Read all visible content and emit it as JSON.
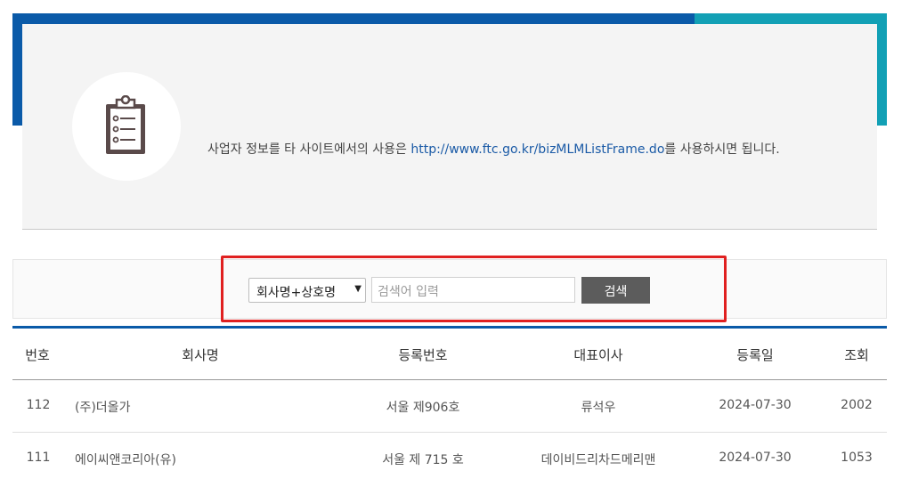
{
  "info": {
    "text_before": "사업자 정보를 타 사이트에서의 사용은 ",
    "link": "http://www.ftc.go.kr/bizMLMListFrame.do",
    "text_after": "를 사용하시면 됩니다.",
    "icon": "clipboard-list-icon"
  },
  "search": {
    "select_value": "회사명+상호명",
    "placeholder": "검색어 입력",
    "button_label": "검색"
  },
  "table": {
    "headers": {
      "no": "번호",
      "company": "회사명",
      "reg_no": "등록번호",
      "ceo": "대표이사",
      "reg_date": "등록일",
      "views": "조회"
    },
    "rows": [
      {
        "no": "112",
        "company": "(주)더올가",
        "reg_no": "서울 제906호",
        "ceo": "류석우",
        "reg_date": "2024-07-30",
        "views": "2002"
      },
      {
        "no": "111",
        "company": "에이씨앤코리아(유)",
        "reg_no": "서울 제 715 호",
        "ceo": "데이비드리차드메리맨",
        "reg_date": "2024-07-30",
        "views": "1053"
      }
    ]
  },
  "colors": {
    "frame_blue": "#0a5aa8",
    "frame_teal": "#12a0b5",
    "highlight_red": "#e02020",
    "button_gray": "#5c5c5c"
  }
}
